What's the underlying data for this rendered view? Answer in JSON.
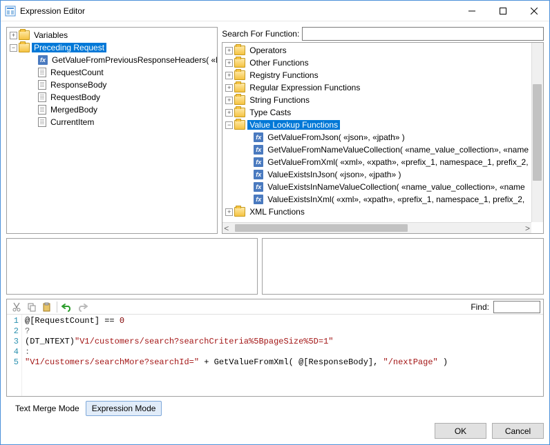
{
  "window": {
    "title": "Expression Editor"
  },
  "leftTree": {
    "variables": "Variables",
    "precedingRequest": "Preceding Request",
    "items": [
      "GetValueFromPreviousResponseHeaders( «header_name» )",
      "RequestCount",
      "ResponseBody",
      "RequestBody",
      "MergedBody",
      "CurrentItem"
    ]
  },
  "search": {
    "label": "Search For Function:",
    "value": ""
  },
  "funcTree": {
    "categories": [
      "Operators",
      "Other Functions",
      "Registry Functions",
      "Regular Expression Functions",
      "String Functions",
      "Type Casts"
    ],
    "valueLookup": {
      "label": "Value Lookup Functions",
      "items": [
        "GetValueFromJson( «json», «jpath» )",
        "GetValueFromNameValueCollection( «name_value_collection», «name",
        "GetValueFromXml( «xml», «xpath», «prefix_1, namespace_1, prefix_2,",
        "ValueExistsInJson( «json», «jpath» )",
        "ValueExistsInNameValueCollection( «name_value_collection», «name",
        "ValueExistsInXml( «xml», «xpath», «prefix_1, namespace_1, prefix_2,"
      ]
    },
    "xmlFunctions": "XML Functions"
  },
  "find": {
    "label": "Find:",
    "value": ""
  },
  "code": {
    "lines": [
      {
        "n": "1",
        "segments": [
          {
            "t": "@[RequestCount]",
            "c": "var"
          },
          {
            "t": " == ",
            "c": "kw"
          },
          {
            "t": "0",
            "c": "num"
          }
        ]
      },
      {
        "n": "2",
        "segments": [
          {
            "t": "?",
            "c": "op"
          }
        ]
      },
      {
        "n": "3",
        "segments": [
          {
            "t": "(DT_NTEXT)",
            "c": "cast"
          },
          {
            "t": "\"V1/customers/search?searchCriteria%5BpageSize%5D=1\"",
            "c": "str"
          }
        ]
      },
      {
        "n": "4",
        "segments": [
          {
            "t": ":",
            "c": "op"
          }
        ]
      },
      {
        "n": "5",
        "segments": [
          {
            "t": "\"V1/customers/searchMore?searchId=\"",
            "c": "str"
          },
          {
            "t": " + GetValueFromXml( ",
            "c": "fn"
          },
          {
            "t": "@[ResponseBody]",
            "c": "var"
          },
          {
            "t": ", ",
            "c": "fn"
          },
          {
            "t": "\"/nextPage\"",
            "c": "str"
          },
          {
            "t": " )",
            "c": "fn"
          }
        ]
      }
    ]
  },
  "modes": {
    "textMerge": "Text Merge Mode",
    "expression": "Expression Mode"
  },
  "buttons": {
    "ok": "OK",
    "cancel": "Cancel"
  }
}
